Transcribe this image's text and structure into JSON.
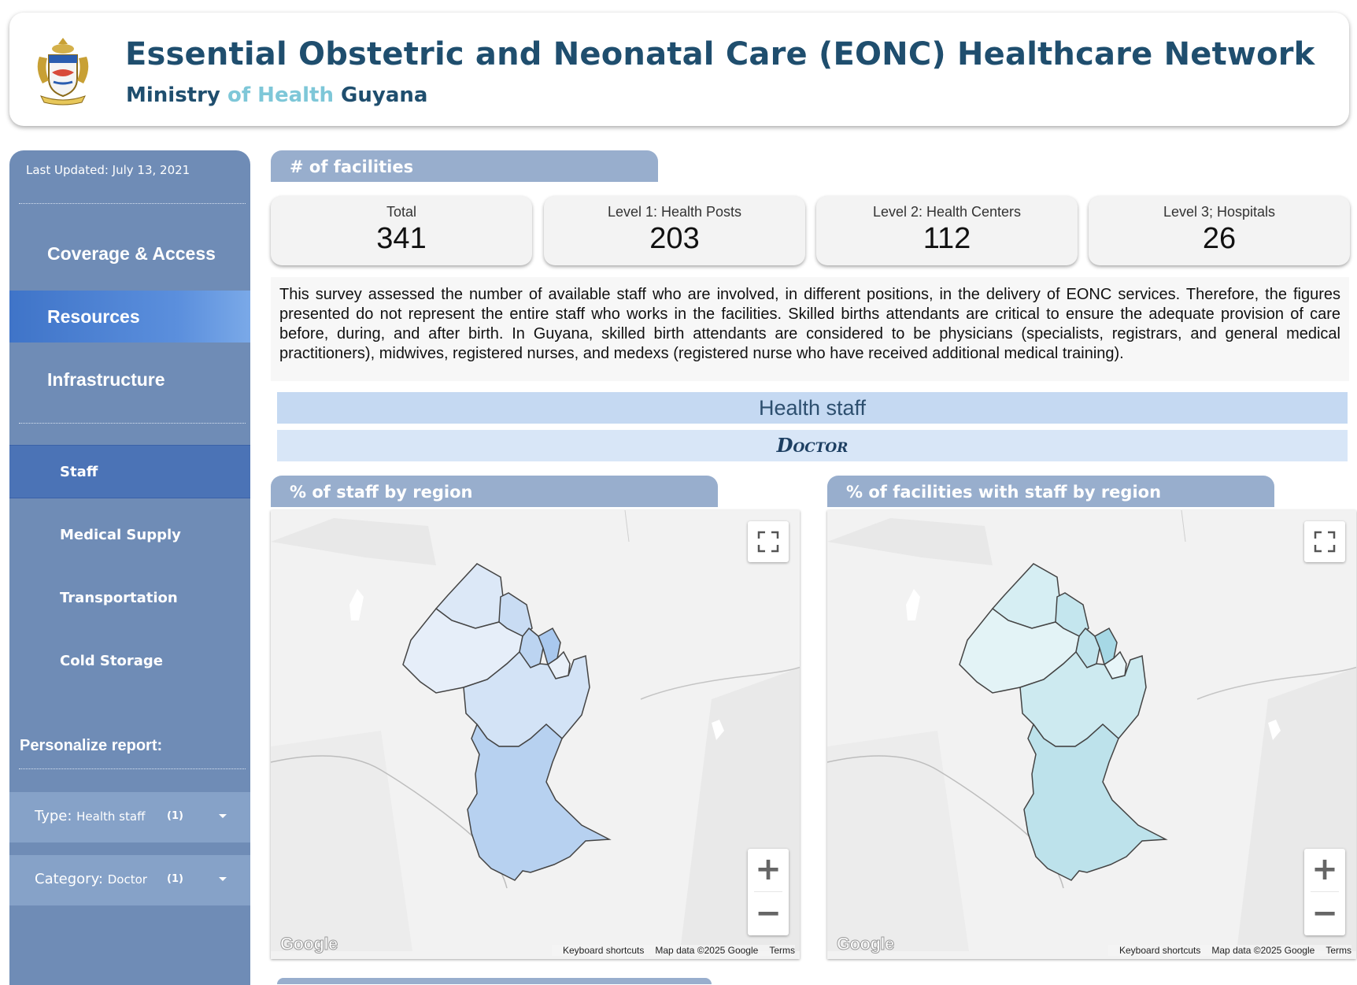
{
  "header": {
    "title": "Essential Obstetric and Neonatal Care (EONC) Healthcare Network",
    "subtitle_part1": "Ministry",
    "subtitle_part2": "of Health",
    "subtitle_part3": "Guyana",
    "logo_icon": "coat-of-arms-icon"
  },
  "sidebar": {
    "last_updated": "Last Updated: July 13, 2021",
    "nav": [
      {
        "label": "Coverage & Access"
      },
      {
        "label": "Resources",
        "active": true
      },
      {
        "label": "Infrastructure"
      }
    ],
    "sub_nav": [
      {
        "label": "Staff",
        "active": true
      },
      {
        "label": "Medical Supply"
      },
      {
        "label": "Transportation"
      },
      {
        "label": "Cold Storage"
      }
    ],
    "personalize_label": "Personalize report:",
    "filters": [
      {
        "label": "Type:",
        "value": "Health staff",
        "count": "(1)"
      },
      {
        "label": "Category:",
        "value": "Doctor",
        "count": "(1)"
      }
    ]
  },
  "main": {
    "facilities_header": "# of facilities",
    "cards": [
      {
        "label": "Total",
        "value": "341"
      },
      {
        "label": "Level 1: Health Posts",
        "value": "203"
      },
      {
        "label": "Level 2: Health Centers",
        "value": "112"
      },
      {
        "label": "Level 3; Hospitals",
        "value": "26"
      }
    ],
    "description": "This survey assessed the number of available staff who are involved, in different positions, in the delivery of EONC services. Therefore, the figures presented do not represent the entire staff who works in the facilities. Skilled births attendants are critical to ensure the adequate provision of care before, during, and after birth. In Guyana, skilled birth attendants are considered to be physicians (specialists, registrars, and general medical practitioners), midwives, registered nurses, and medexs (registered nurse who have received additional medical training).",
    "band_title": "Health staff",
    "band_subtitle": "Doctor",
    "map_left": {
      "header": "% of staff by region",
      "fill_colors": [
        "#dce8f7",
        "#c9dcf3",
        "#e6eef9",
        "#bcd4f1",
        "#a9c8ee",
        "#e9f0f9",
        "#d3e3f6",
        "#b7d1f0"
      ]
    },
    "map_right": {
      "header": "% of facilities with staff by region",
      "fill_colors": [
        "#d6eef3",
        "#c4e6ee",
        "#e3f3f6",
        "#bfe3ec",
        "#a6d8e5",
        "#e8f5f8",
        "#cdeaf0",
        "#bde2eb"
      ]
    },
    "map_common": {
      "google_logo": "Google",
      "keyboard": "Keyboard shortcuts",
      "map_data": "Map data ©2025 Google",
      "terms": "Terms",
      "zoom_in": "+",
      "zoom_out": "−"
    }
  }
}
